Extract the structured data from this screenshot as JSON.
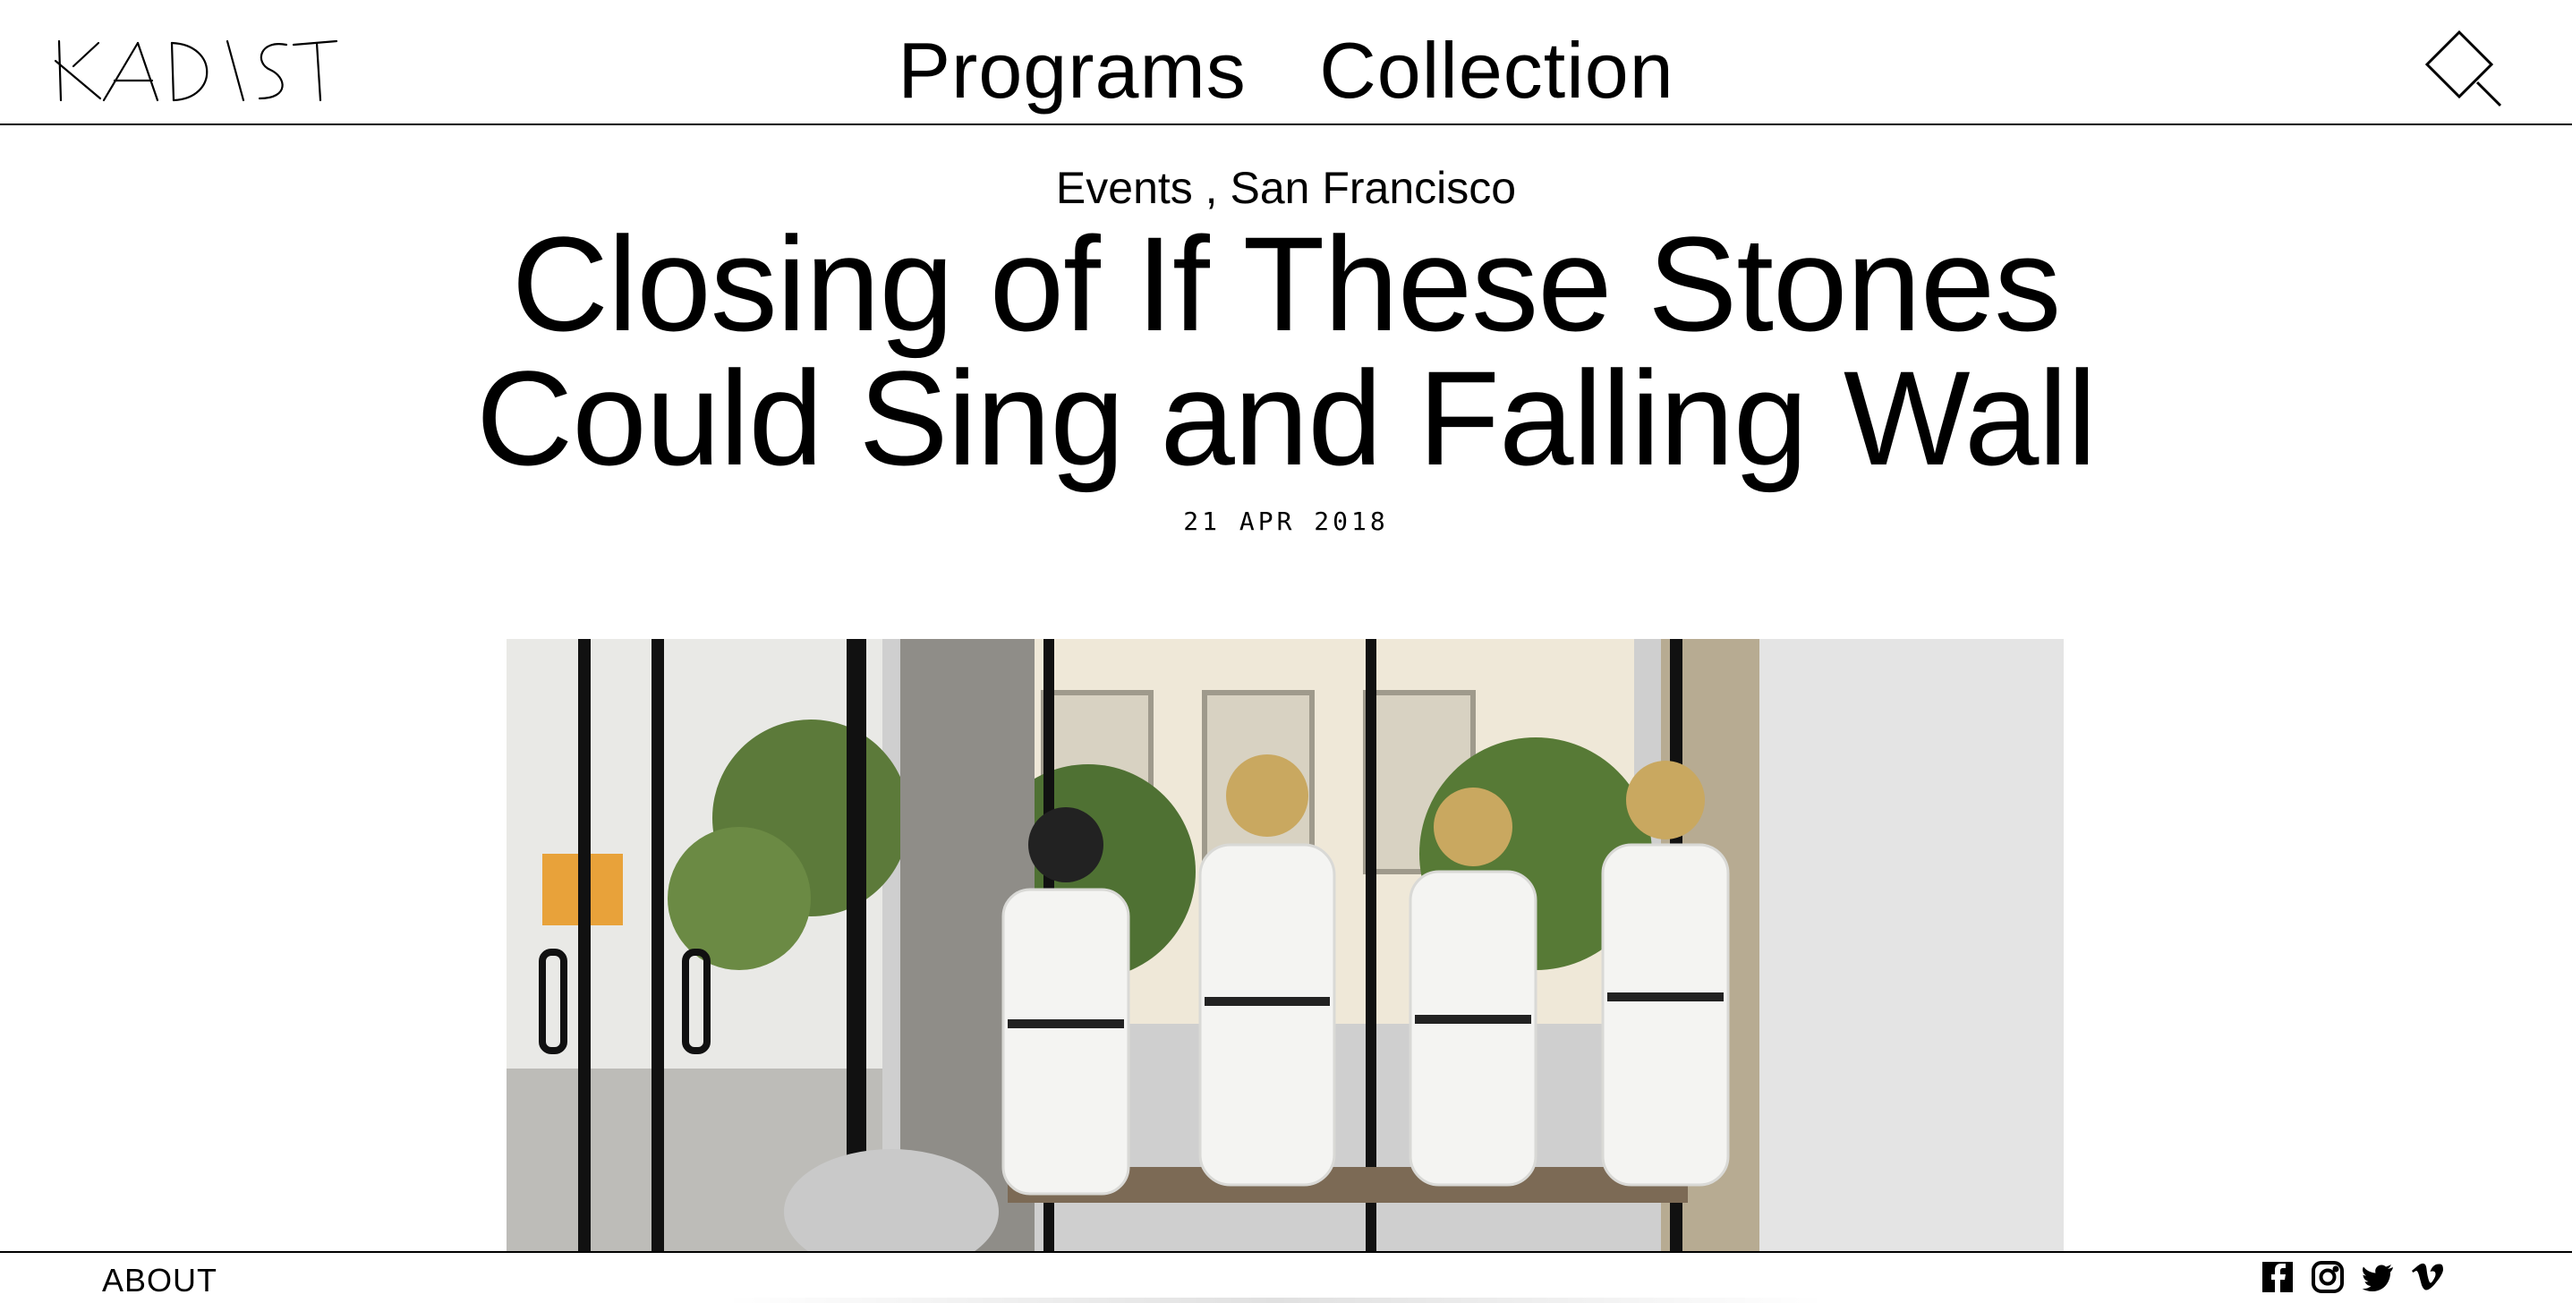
{
  "brand": {
    "logo_text": "KADIST"
  },
  "nav": {
    "items": [
      {
        "label": "Programs"
      },
      {
        "label": "Collection"
      }
    ]
  },
  "article": {
    "kicker": {
      "category": "Events",
      "separator": " , ",
      "location": "San Francisco"
    },
    "title_line1": "Closing of If These Stones",
    "title_line2": "Could Sing and Falling Wall",
    "date": "21 APR 2018"
  },
  "footer": {
    "about_label": "ABOUT",
    "social_icons": [
      "facebook-icon",
      "instagram-icon",
      "twitter-icon",
      "vimeo-icon"
    ]
  },
  "colors": {
    "text": "#000000",
    "background": "#ffffff"
  }
}
